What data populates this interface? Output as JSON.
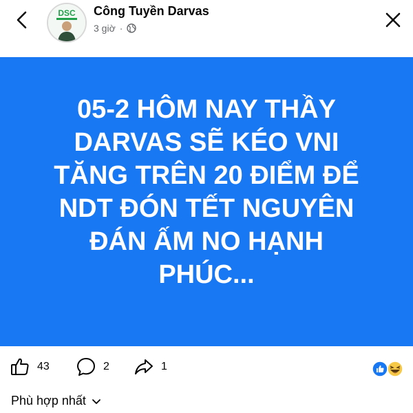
{
  "post": {
    "author": "Công Tuyền Darvas",
    "time": "3 giờ",
    "dot": "·",
    "avatar_badge": "DSC",
    "text": "05-2 HÔM NAY THẦY\nDARVAS SẼ KÉO VNI\nTĂNG TRÊN 20 ĐIỂM ĐỂ\nNDT ĐÓN TẾT NGUYÊN\nĐÁN ẤM NO HẠNH\nPHÚC...",
    "background_color": "#1877f2"
  },
  "actions": {
    "likes": "43",
    "comments": "2",
    "shares": "1"
  },
  "comments": {
    "sort_label": "Phù hợp nhất"
  },
  "icons": [
    "back-arrow-icon",
    "globe-icon",
    "close-icon",
    "like-icon",
    "comment-icon",
    "share-icon",
    "like-reaction-icon",
    "haha-reaction-icon",
    "chevron-down-icon"
  ]
}
